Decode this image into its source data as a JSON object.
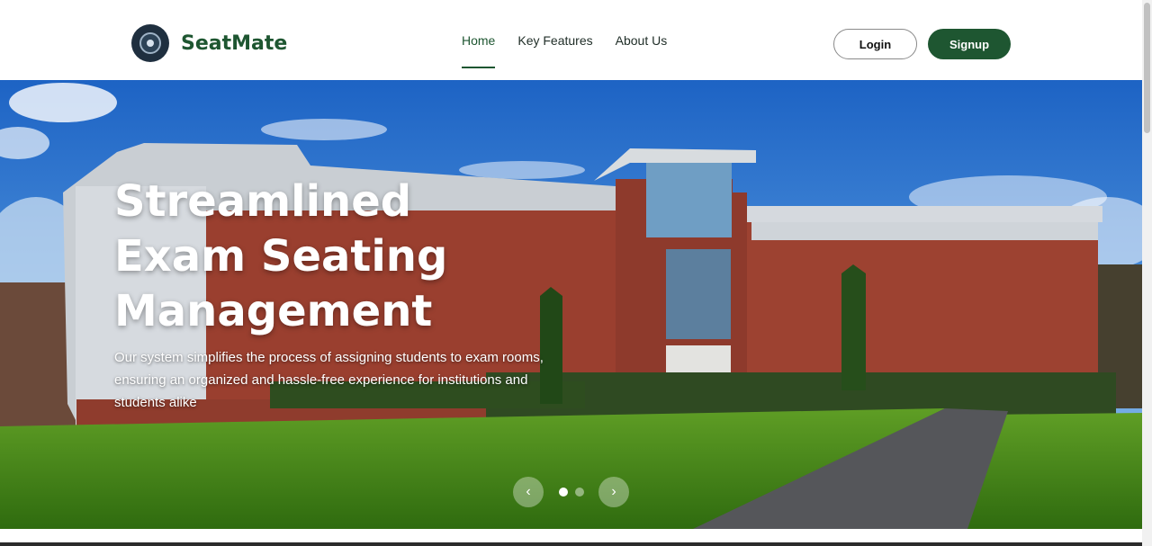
{
  "brand": {
    "name": "SeatMate",
    "logo_icon": "university-seal-icon"
  },
  "nav": {
    "items": [
      {
        "label": "Home",
        "active": true
      },
      {
        "label": "Key Features",
        "active": false
      },
      {
        "label": "About Us",
        "active": false
      }
    ]
  },
  "auth": {
    "login_label": "Login",
    "signup_label": "Signup"
  },
  "hero": {
    "title": "Streamlined Exam Seating Management",
    "subtitle": "Our system simplifies the process of assigning students to exam rooms, ensuring an organized and hassle-free experience for institutions and students alike"
  },
  "carousel": {
    "prev_icon": "chevron-left-icon",
    "next_icon": "chevron-right-icon",
    "slide_count": 2,
    "active_index": 0
  },
  "colors": {
    "accent": "#1e5631",
    "text_dark": "#1f2d27"
  }
}
